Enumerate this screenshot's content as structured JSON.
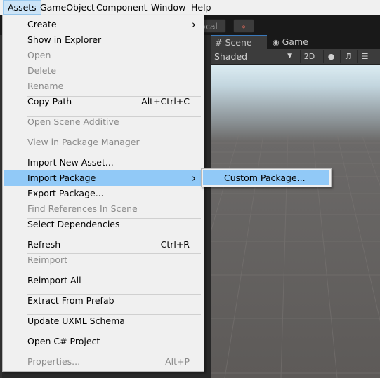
{
  "menubar": {
    "items": [
      {
        "label": "Assets",
        "active": true
      },
      {
        "label": "GameObject"
      },
      {
        "label": "Component"
      },
      {
        "label": "Window"
      },
      {
        "label": "Help"
      }
    ]
  },
  "toolbar": {
    "local_label": "ocal"
  },
  "scene": {
    "tabs": [
      {
        "label": "Scene",
        "icon": "hash-icon",
        "selected": true
      },
      {
        "label": "Game",
        "icon": "gamepad-icon"
      }
    ],
    "shading_mode": "Shaded",
    "mode_2d": "2D"
  },
  "assets_menu": {
    "items": [
      {
        "label": "Create",
        "arrow": true
      },
      {
        "label": "Show in Explorer"
      },
      {
        "label": "Open",
        "disabled": true
      },
      {
        "label": "Delete",
        "disabled": true
      },
      {
        "label": "Rename",
        "disabled": true
      },
      {
        "label": "Copy Path",
        "shortcut": "Alt+Ctrl+C"
      },
      {
        "label": "Open Scene Additive",
        "disabled": true
      },
      {
        "label": "View in Package Manager",
        "disabled": true
      },
      {
        "label": "Import New Asset..."
      },
      {
        "label": "Import Package",
        "arrow": true,
        "highlighted": true
      },
      {
        "label": "Export Package..."
      },
      {
        "label": "Find References In Scene",
        "disabled": true
      },
      {
        "label": "Select Dependencies"
      },
      {
        "label": "Refresh",
        "shortcut": "Ctrl+R"
      },
      {
        "label": "Reimport",
        "disabled": true
      },
      {
        "label": "Reimport All"
      },
      {
        "label": "Extract From Prefab"
      },
      {
        "label": "Update UXML Schema"
      },
      {
        "label": "Open C# Project"
      },
      {
        "label": "Properties...",
        "shortcut": "Alt+P",
        "disabled": true
      }
    ]
  },
  "import_package_submenu": {
    "items": [
      {
        "label": "Custom Package..."
      }
    ]
  },
  "colors": {
    "menu_bg": "#f0f0f0",
    "highlight": "#91c9f7",
    "disabled_text": "#8a8a8a",
    "editor_dark": "#282828"
  }
}
